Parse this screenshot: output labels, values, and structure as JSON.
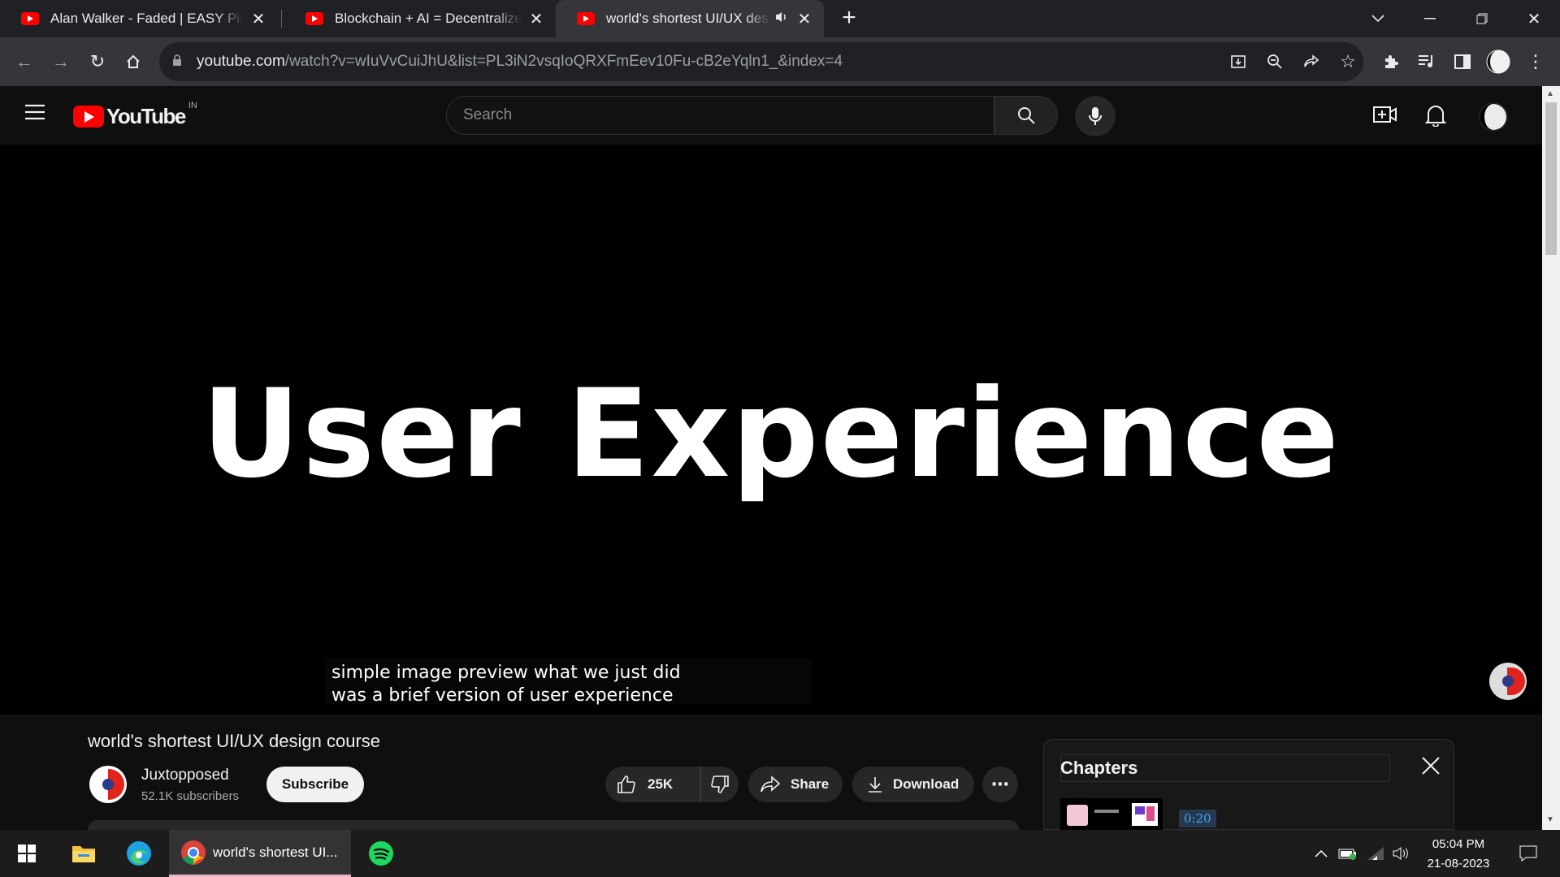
{
  "browser": {
    "tabs": [
      {
        "title": "Alan Walker - Faded | EASY Piano",
        "active": false
      },
      {
        "title": "Blockchain + AI = Decentralized AI",
        "active": false
      },
      {
        "title": "world's shortest UI/UX design course",
        "active": true
      }
    ],
    "url_host": "youtube.com",
    "url_path": "/watch?v=wIuVvCuiJhU&list=PL3iN2vsqIoQRXFmEev10Fu-cB2eYqln1_&index=4"
  },
  "youtube": {
    "logo_text": "YouTube",
    "country_code": "IN",
    "search_placeholder": "Search"
  },
  "video": {
    "frame_text": "User Experience",
    "caption_line1": "simple image preview what we just did",
    "caption_line2": "was a brief version of user experience",
    "title": "world's shortest UI/UX design course",
    "channel": "Juxtopposed",
    "subscribers": "52.1K subscribers",
    "subscribe_label": "Subscribe",
    "likes": "25K",
    "share_label": "Share",
    "download_label": "Download"
  },
  "chapters": {
    "header": "Chapters",
    "first_timestamp": "0:20"
  },
  "taskbar": {
    "active_window": "world's shortest UI...",
    "time": "05:04 PM",
    "date": "21-08-2023"
  },
  "colors": {
    "youtube_red": "#ff0000",
    "link_blue": "#3ea6ff",
    "spotify_green": "#1ed760"
  }
}
